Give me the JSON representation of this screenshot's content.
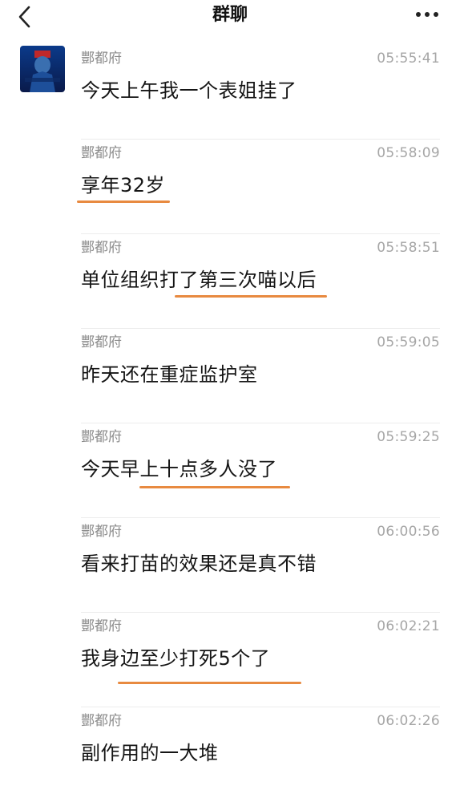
{
  "header": {
    "title": "群聊"
  },
  "icons": {
    "back": "chevron-left-icon",
    "more": "more-horizontal-icon"
  },
  "accent_color": "#e88a40",
  "messages": [
    {
      "sender": "酆都府",
      "time": "05:55:41",
      "text": "今天上午我一个表姐挂了"
    },
    {
      "sender": "酆都府",
      "time": "05:58:09",
      "text": "享年32岁"
    },
    {
      "sender": "酆都府",
      "time": "05:58:51",
      "text": "单位组织打了第三次喵以后"
    },
    {
      "sender": "酆都府",
      "time": "05:59:05",
      "text": "昨天还在重症监护室"
    },
    {
      "sender": "酆都府",
      "time": "05:59:25",
      "text": "今天早上十点多人没了"
    },
    {
      "sender": "酆都府",
      "time": "06:00:56",
      "text": "看来打苗的效果还是真不错"
    },
    {
      "sender": "酆都府",
      "time": "06:02:21",
      "text": "我身边至少打死5个了"
    },
    {
      "sender": "酆都府",
      "time": "06:02:26",
      "text": "副作用的一大堆"
    }
  ]
}
